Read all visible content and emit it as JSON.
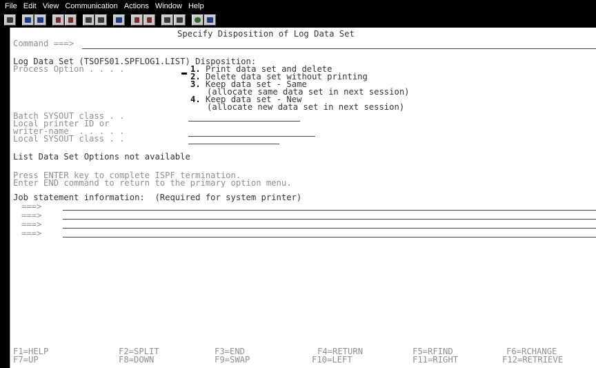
{
  "menubar": {
    "items": [
      "File",
      "Edit",
      "View",
      "Communication",
      "Actions",
      "Window",
      "Help"
    ]
  },
  "toolbar": {
    "buttons": [
      "print-screen-icon",
      "copy-icon",
      "paste-icon",
      "send-file-icon",
      "receive-file-icon",
      "macro-record-icon",
      "macro-play-icon",
      "display-icon",
      "transfer-up-icon",
      "transfer-down-icon",
      "keypad-icon",
      "keyboard-map-icon",
      "color-palette-icon",
      "help-icon"
    ]
  },
  "screen": {
    "title": "Specify Disposition of Log Data Set",
    "command_label": "Command ===>",
    "log_heading": "Log Data Set (TSOFS01.SPFLOG1.LIST) Disposition:",
    "process_label": "Process Option . . . .",
    "options": [
      {
        "num": "1.",
        "text": "Print data set and delete"
      },
      {
        "num": "2.",
        "text": "Delete data set without printing"
      },
      {
        "num": "3.",
        "text": "Keep data set - Same"
      },
      {
        "num": "",
        "text": "(allocate same data set in next session)"
      },
      {
        "num": "4.",
        "text": "Keep data set - New"
      },
      {
        "num": "",
        "text": "(allocate new data set in next session)"
      }
    ],
    "batch_label": "Batch SYSOUT class . .",
    "local_printer_label": "Local printer ID or",
    "writer_label": "writer-name  . . . . .",
    "local_sysout_label": "Local SYSOUT class . .",
    "list_options": "List Data Set Options not available",
    "press_line": "Press ENTER key to complete ISPF termination.",
    "enter_line": "Enter END command to return to the primary option menu.",
    "job_label": "Job statement information:  (Required for system printer)",
    "job_prompts": [
      "===>",
      "===>",
      "===>",
      "===>"
    ],
    "fkeys": [
      "F1=HELP",
      "F2=SPLIT",
      "F3=END",
      "F4=RETURN",
      "F5=RFIND",
      "F6=RCHANGE",
      "F7=UP",
      "F8=DOWN",
      "F9=SWAP",
      "F10=LEFT",
      "F11=RIGHT",
      "F12=RETRIEVE"
    ]
  }
}
